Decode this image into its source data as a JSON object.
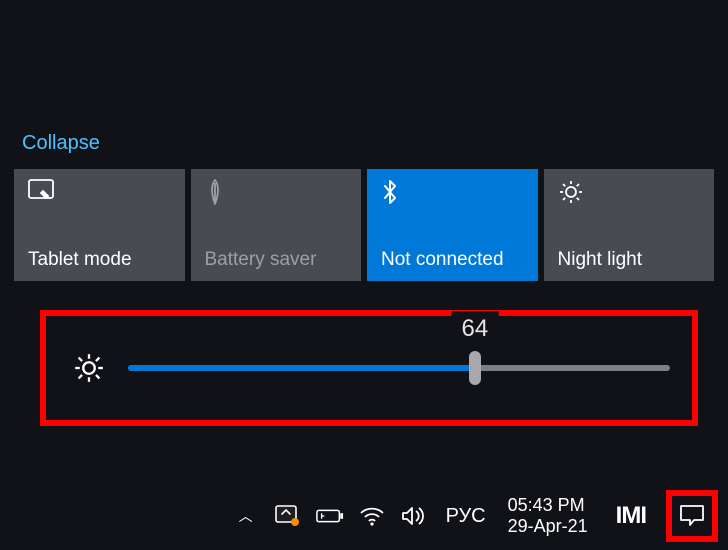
{
  "collapse_label": "Collapse",
  "tiles": [
    {
      "label": "Tablet mode",
      "icon": "tablet-mode-icon",
      "state": "off"
    },
    {
      "label": "Battery saver",
      "icon": "leaf-icon",
      "state": "disabled"
    },
    {
      "label": "Not connected",
      "icon": "bluetooth-icon",
      "state": "on"
    },
    {
      "label": "Night light",
      "icon": "night-light-icon",
      "state": "off"
    }
  ],
  "brightness": {
    "value": 64,
    "tooltip": "64",
    "percent": 64
  },
  "taskbar": {
    "language": "РУС",
    "time": "05:43 PM",
    "date": "29-Apr-21",
    "tray": {
      "chevron": "▲",
      "windows_update": "windows-update-icon",
      "battery": "battery-charging-icon",
      "wifi": "wifi-icon",
      "volume": "volume-icon"
    },
    "brand": "IMI"
  },
  "colors": {
    "accent": "#0078d7",
    "highlight": "#ff0000",
    "tile_bg": "#484c52"
  }
}
